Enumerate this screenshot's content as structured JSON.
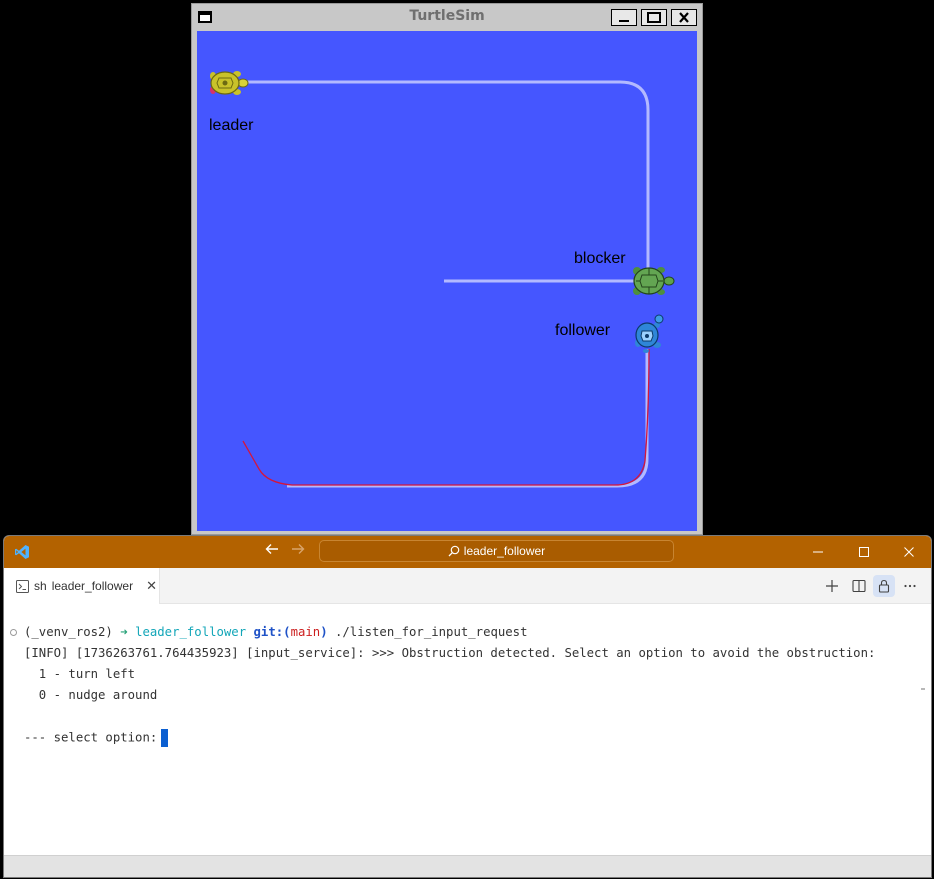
{
  "turtlesim": {
    "title": "TurtleSim",
    "background_color": "#4556ff",
    "path_color": "#b3b9ff",
    "follower_trail_color": "#d4163c",
    "turtles": [
      {
        "name": "leader",
        "label": "leader",
        "shell_color": "#c9c22a"
      },
      {
        "name": "blocker",
        "label": "blocker",
        "shell_color": "#4e8f3e"
      },
      {
        "name": "follower",
        "label": "follower",
        "shell_color": "#2f86d8"
      }
    ]
  },
  "vscode": {
    "titlebar_color": "#b36200",
    "search_text": "leader_follower",
    "tab": {
      "prefix": "sh",
      "label": "leader_follower"
    },
    "terminal": {
      "prompt": {
        "venv": "(_venv_ros2)",
        "arrow": "➜",
        "dir": "leader_follower",
        "git_label": "git:(",
        "branch": "main",
        "git_close": ")",
        "command": "./listen_for_input_request"
      },
      "info_line": "[INFO] [1736263761.764435923] [input_service]: >>> Obstruction detected. Select an option to avoid the obstruction:",
      "options": [
        "  1 - turn left",
        "  0 - nudge around"
      ],
      "select_prompt": "--- select option:"
    }
  }
}
